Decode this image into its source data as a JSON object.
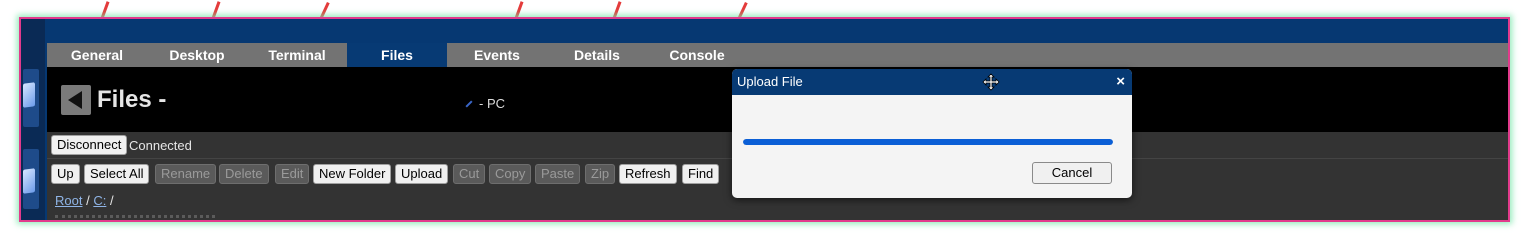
{
  "tabs": [
    {
      "label": "General"
    },
    {
      "label": "Desktop"
    },
    {
      "label": "Terminal"
    },
    {
      "label": "Files",
      "active": true
    },
    {
      "label": "Events"
    },
    {
      "label": "Details"
    },
    {
      "label": "Console"
    }
  ],
  "header": {
    "title": "Files -",
    "device": "- PC"
  },
  "connection": {
    "disconnect_label": "Disconnect",
    "status": "Connected"
  },
  "toolbar": {
    "up": "Up",
    "select_all": "Select All",
    "rename": "Rename",
    "delete": "Delete",
    "edit": "Edit",
    "new_folder": "New Folder",
    "upload": "Upload",
    "cut": "Cut",
    "copy": "Copy",
    "paste": "Paste",
    "zip": "Zip",
    "refresh": "Refresh",
    "find": "Find"
  },
  "breadcrumb": {
    "root": "Root",
    "sep1": "/",
    "drive": "C:",
    "sep2": "/"
  },
  "dialog": {
    "title": "Upload File",
    "close": "×",
    "progress": 1.0,
    "cancel_label": "Cancel"
  },
  "colors": {
    "accent": "#073a74",
    "progress": "#0b5fd6",
    "annotation": "#e43b3b",
    "frame": "#e23a8c"
  }
}
